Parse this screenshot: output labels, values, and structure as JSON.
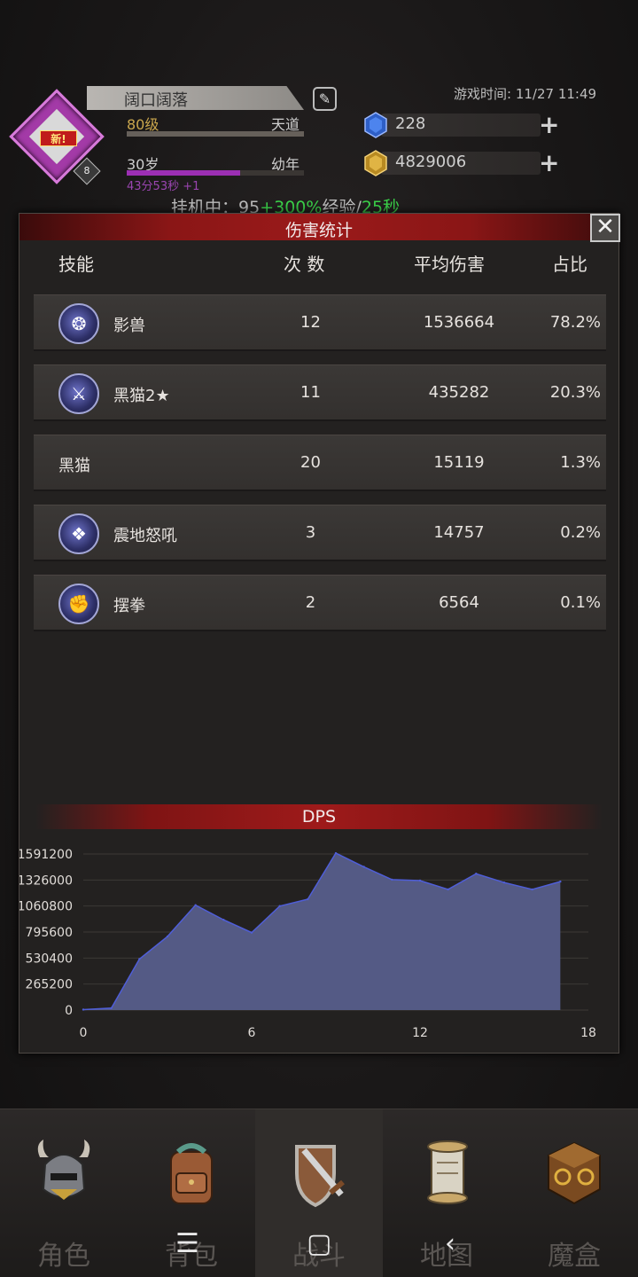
{
  "header": {
    "avatar_badge": "新!",
    "avatar_level": "8",
    "player_name": "阔口阔落",
    "level": "80级",
    "realm": "天道",
    "age": "30岁",
    "age_stage": "幼年",
    "age_timer": "43分53秒 +1",
    "game_time": "游戏时间: 11/27 11:49",
    "gems": "228",
    "gold": "4829006",
    "idle_prefix": "挂机中：",
    "idle_value": "95",
    "idle_bonus": "+300%",
    "idle_exp": "经验/",
    "idle_interval": "25秒"
  },
  "modal": {
    "title": "伤害统计",
    "close_label": "✕",
    "columns": {
      "skill": "技能",
      "count": "次 数",
      "avg": "平均伤害",
      "ratio": "占比"
    },
    "rows": [
      {
        "name": "影兽",
        "count": "12",
        "avg": "1536664",
        "ratio": "78.2%",
        "icon": "shadow-beast-icon",
        "has_icon": true
      },
      {
        "name": "黑猫2★",
        "count": "11",
        "avg": "435282",
        "ratio": "20.3%",
        "icon": "sword-icon",
        "has_icon": true
      },
      {
        "name": "黑猫",
        "count": "20",
        "avg": "15119",
        "ratio": "1.3%",
        "icon": "",
        "has_icon": false
      },
      {
        "name": "震地怒吼",
        "count": "3",
        "avg": "14757",
        "ratio": "0.2%",
        "icon": "roar-icon",
        "has_icon": true
      },
      {
        "name": "摆拳",
        "count": "2",
        "avg": "6564",
        "ratio": "0.1%",
        "icon": "fist-icon",
        "has_icon": true
      }
    ],
    "dps_title": "DPS"
  },
  "chart_data": {
    "type": "area",
    "title": "DPS",
    "xlabel": "",
    "ylabel": "",
    "x": [
      0,
      1,
      2,
      3,
      4,
      5,
      6,
      7,
      8,
      9,
      10,
      11,
      12,
      13,
      14,
      15,
      16,
      17
    ],
    "series": [
      {
        "values": [
          5000,
          20000,
          520000,
          750000,
          1070000,
          920000,
          790000,
          1060000,
          1130000,
          1600000,
          1460000,
          1330000,
          1320000,
          1230000,
          1390000,
          1300000,
          1230000,
          1310000
        ]
      }
    ],
    "xlim": [
      0,
      18
    ],
    "ylim": [
      0,
      1591200
    ],
    "xticks": [
      "0",
      "6",
      "12",
      "18"
    ],
    "yticks": [
      "0",
      "265200",
      "530400",
      "795600",
      "1060800",
      "1326000",
      "1591200"
    ],
    "grid": true,
    "fill_color": "#545a85",
    "line_color": "#4f5ed8"
  },
  "nav": {
    "items": [
      {
        "label": "角色",
        "icon": "helmet-icon"
      },
      {
        "label": "背包",
        "icon": "backpack-icon"
      },
      {
        "label": "战斗",
        "icon": "shield-sword-icon"
      },
      {
        "label": "地图",
        "icon": "scroll-map-icon"
      },
      {
        "label": "魔盒",
        "icon": "magic-box-icon"
      }
    ],
    "active_index": 2
  }
}
